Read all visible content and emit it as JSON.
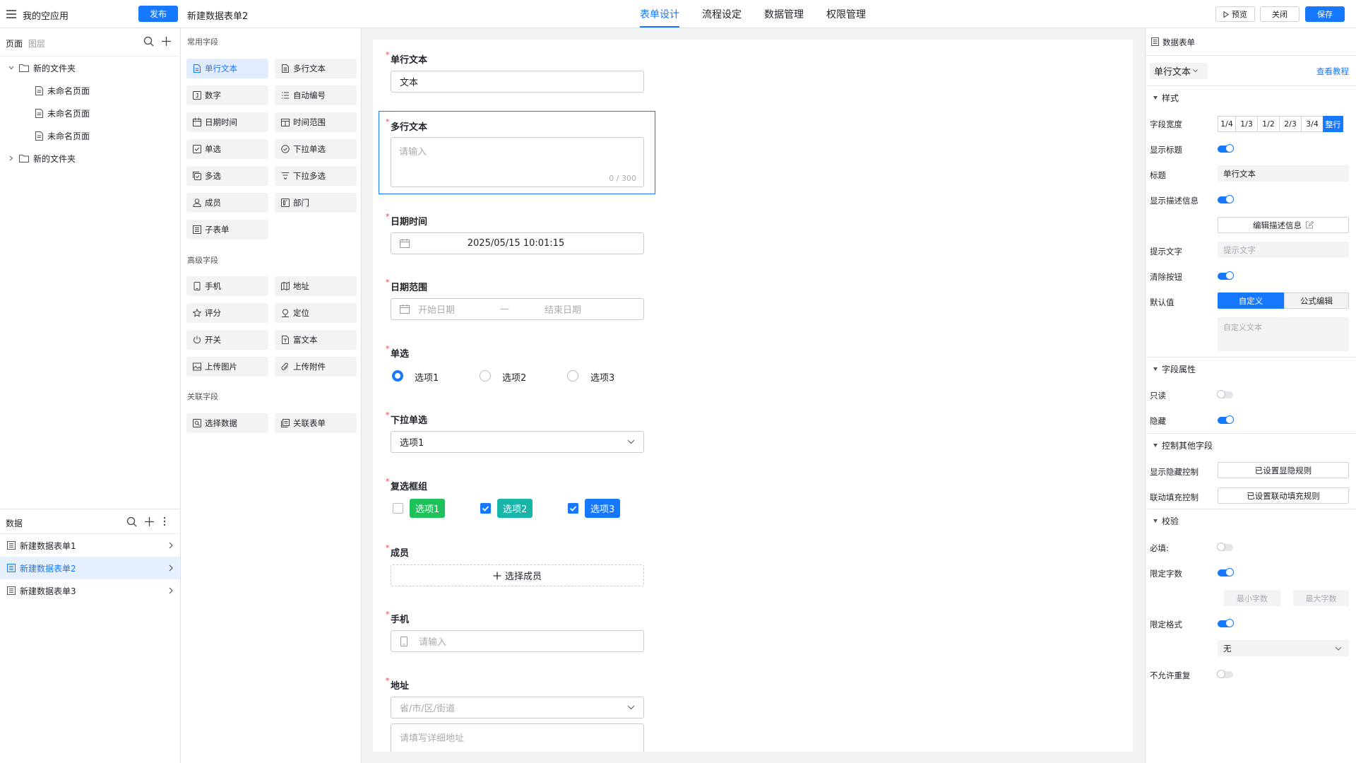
{
  "app": {
    "title": "我的空应用",
    "publish_label": "发布",
    "form_name": "新建数据表单2"
  },
  "tabs": [
    {
      "label": "表单设计",
      "active": true
    },
    {
      "label": "流程设定"
    },
    {
      "label": "数据管理"
    },
    {
      "label": "权限管理"
    }
  ],
  "actions": {
    "preview": "预览",
    "close": "关闭",
    "save": "保存"
  },
  "left": {
    "tab_pages": "页面",
    "tab_layers": "图层",
    "tree": [
      {
        "label": "新的文件夹",
        "type": "folder",
        "expanded": true
      },
      {
        "label": "未命名页面",
        "type": "page"
      },
      {
        "label": "未命名页面",
        "type": "page"
      },
      {
        "label": "未命名页面",
        "type": "page"
      },
      {
        "label": "新的文件夹",
        "type": "folder",
        "expanded": false
      }
    ],
    "data_title": "数据",
    "data_items": [
      {
        "label": "新建数据表单1",
        "selected": false
      },
      {
        "label": "新建数据表单2",
        "selected": true
      },
      {
        "label": "新建数据表单3",
        "selected": false
      }
    ]
  },
  "palette": {
    "common_title": "常用字段",
    "common": [
      "单行文本",
      "多行文本",
      "数字",
      "自动编号",
      "日期时间",
      "时间范围",
      "单选",
      "下拉单选",
      "多选",
      "下拉多选",
      "成员",
      "部门",
      "子表单"
    ],
    "advanced_title": "高级字段",
    "advanced": [
      "手机",
      "地址",
      "评分",
      "定位",
      "开关",
      "富文本",
      "上传图片",
      "上传附件"
    ],
    "related_title": "关联字段",
    "related": [
      "选择数据",
      "关联表单"
    ]
  },
  "form": {
    "single_text": {
      "label": "单行文本",
      "value": "文本"
    },
    "multi_text": {
      "label": "多行文本",
      "placeholder": "请输入",
      "counter": "0 / 300"
    },
    "datetime": {
      "label": "日期时间",
      "value": "2025/05/15  10:01:15"
    },
    "daterange": {
      "label": "日期范围",
      "start_ph": "开始日期",
      "sep": "—",
      "end_ph": "结束日期"
    },
    "radio": {
      "label": "单选",
      "options": [
        "选项1",
        "选项2",
        "选项3"
      ],
      "selected": 0
    },
    "dropdown": {
      "label": "下拉单选",
      "value": "选项1"
    },
    "checkbox": {
      "label": "复选框组",
      "options": [
        {
          "label": "选项1",
          "checked": false,
          "color": "#1fc15a"
        },
        {
          "label": "选项2",
          "checked": true,
          "color": "#18b5a8"
        },
        {
          "label": "选项3",
          "checked": true,
          "color": "#1677ff"
        }
      ]
    },
    "member": {
      "label": "成员",
      "button": "选择成员"
    },
    "phone": {
      "label": "手机",
      "placeholder": "请输入"
    },
    "address": {
      "label": "地址",
      "region_ph": "省/市/区/街道",
      "detail_ph": "请填写详细地址"
    }
  },
  "right": {
    "header": "数据表单",
    "field_type": "单行文本",
    "tutorial": "查看教程",
    "style_section": "样式",
    "width_label": "字段宽度",
    "widths": [
      "1/4",
      "1/3",
      "1/2",
      "2/3",
      "3/4",
      "整行"
    ],
    "width_selected": 5,
    "show_title": "显示标题",
    "title_label": "标题",
    "title_value": "单行文本",
    "show_desc": "显示描述信息",
    "edit_desc": "编辑描述信息",
    "hint_label": "提示文字",
    "hint_ph": "提示文字",
    "clear_btn": "清除按钮",
    "default_label": "默认值",
    "default_custom": "自定义",
    "default_formula": "公式编辑",
    "default_ph": "自定义文本",
    "prop_section": "字段属性",
    "readonly": "只读",
    "hidden": "隐藏",
    "control_section": "控制其他字段",
    "show_hide_ctrl": "显示隐藏控制",
    "show_hide_rule": "已设置显隐规则",
    "fill_ctrl": "联动填充控制",
    "fill_rule": "已设置联动填充规则",
    "verify_section": "校验",
    "required": "必填:",
    "limit_chars": "限定字数",
    "min_chars": "最小字数",
    "max_chars": "最大字数",
    "limit_format": "限定格式",
    "format_value": "无",
    "no_dup": "不允许重复"
  }
}
